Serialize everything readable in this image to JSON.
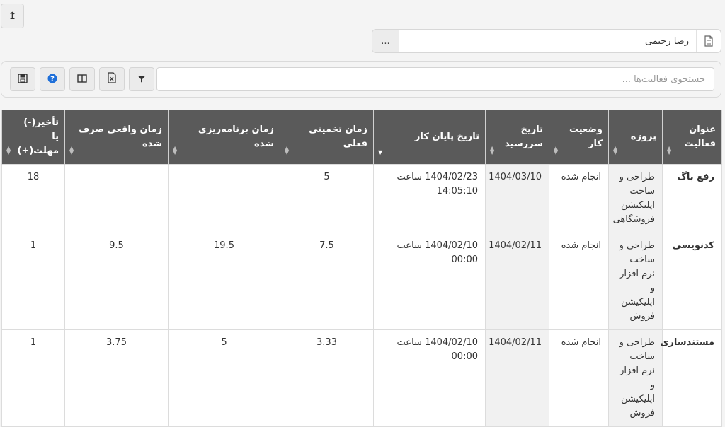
{
  "top_button": {
    "icon": "arrow-up-icon",
    "glyph": "↥"
  },
  "user": {
    "name": "رضا رحیمی",
    "more_label": "..."
  },
  "toolbar": {
    "search_placeholder": "جستجوی فعالیت‌ها ..."
  },
  "table": {
    "columns": [
      "عنوان فعالیت",
      "پروژه",
      "وضعیت کار",
      "تاریخ سررسید",
      "تاریخ پایان کار",
      "زمان تخمینی فعلی",
      "زمان برنامه‌ریزی شده",
      "زمان واقعی صرف شده",
      "تأخیر(-) یا مهلت(+)"
    ],
    "rows": [
      {
        "title": "رفع باگ",
        "project": "طراحی و ساخت اپلیکیشن فروشگاهی",
        "status": "انجام شده",
        "due": "1404/03/10",
        "end": "1404/02/23 ساعت 14:05:10",
        "estimate": "5",
        "planned": "",
        "actual": "",
        "delay": "18"
      },
      {
        "title": "کدنویسی",
        "project": "طراحی و ساخت نرم افزار و اپلیکیشن فروش",
        "status": "انجام شده",
        "due": "1404/02/11",
        "end": "1404/02/10 ساعت 00:00",
        "estimate": "7.5",
        "planned": "19.5",
        "actual": "9.5",
        "delay": "1"
      },
      {
        "title": "مستندسازی",
        "project": "طراحی و ساخت نرم افزار و اپلیکیشن فروش",
        "status": "انجام شده",
        "due": "1404/02/11",
        "end": "1404/02/10 ساعت 00:00",
        "estimate": "3.33",
        "planned": "5",
        "actual": "3.75",
        "delay": "1"
      }
    ]
  }
}
